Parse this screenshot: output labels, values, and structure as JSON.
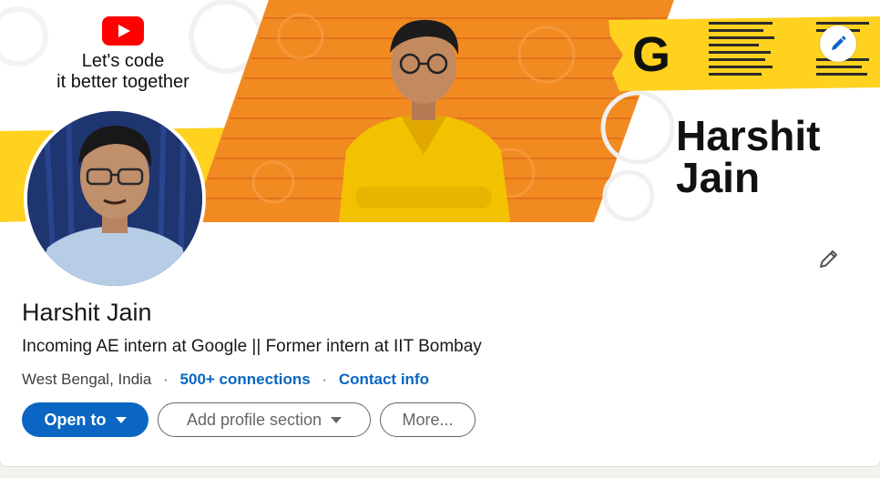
{
  "banner": {
    "tagline_line1": "Let's code",
    "tagline_line2": "it better together",
    "logo_letter": "G",
    "name_line1": "Harshit",
    "name_line2": "Jain",
    "accent_orange": "#f28a22",
    "accent_yellow": "#ffd21f",
    "youtube_red": "#ff0000"
  },
  "profile": {
    "name": "Harshit Jain",
    "headline": "Incoming AE intern at Google || Former intern at IIT Bombay",
    "location": "West Bengal, India",
    "separator": "·",
    "connections": "500+ connections",
    "contact": "Contact info"
  },
  "actions": {
    "open_to": "Open to",
    "add_section": "Add profile section",
    "more": "More..."
  },
  "icons": {
    "cover_edit": "pencil-icon",
    "intro_edit": "pencil-icon",
    "youtube": "youtube-logo"
  },
  "colors": {
    "link_blue": "#0a66c2",
    "primary_button": "#0a66c2"
  }
}
